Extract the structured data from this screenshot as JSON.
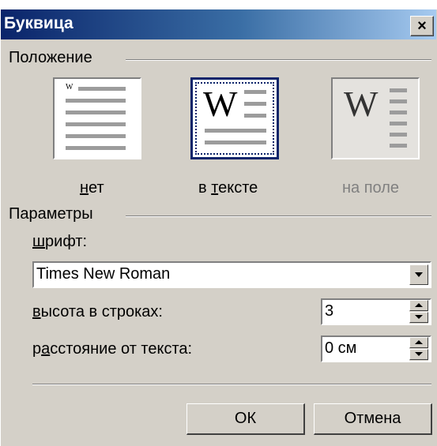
{
  "dialog": {
    "title": "Буквица",
    "close_label": "×"
  },
  "position": {
    "group_label": "Положение",
    "options": [
      {
        "label_pre": "",
        "label_u": "н",
        "label_post": "ет",
        "icon": "dropcap-none-icon",
        "selected": false,
        "enabled": true
      },
      {
        "label_pre": "в ",
        "label_u": "т",
        "label_post": "ексте",
        "icon": "dropcap-in-text-icon",
        "selected": true,
        "enabled": true
      },
      {
        "label_pre": "на поле",
        "label_u": "",
        "label_post": "",
        "icon": "dropcap-in-margin-icon",
        "selected": false,
        "enabled": false
      }
    ],
    "glyph": "W"
  },
  "params": {
    "group_label": "Параметры",
    "font_label_u": "ш",
    "font_label_post": "рифт:",
    "font_value": "Times New Roman",
    "lines_label_u": "в",
    "lines_label_post": "ысота в строках:",
    "lines_value": "3",
    "dist_label_pre": "р",
    "dist_label_u": "а",
    "dist_label_post": "сстояние от текста:",
    "dist_value": "0 см"
  },
  "buttons": {
    "ok": "ОК",
    "cancel": "Отмена"
  },
  "colors": {
    "titlebar_start": "#0a246a",
    "titlebar_end": "#a6caf0",
    "face": "#d4d0c8"
  }
}
